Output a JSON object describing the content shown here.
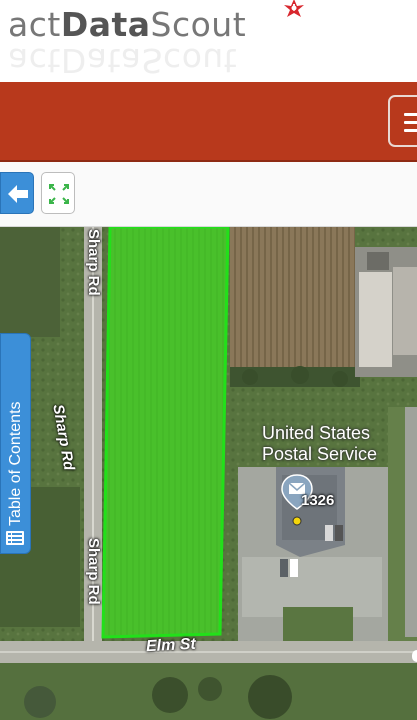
{
  "header": {
    "logo_part1": "act",
    "logo_part2": "Data",
    "logo_part3": "Scout",
    "logo_icon": "red-star-icon"
  },
  "navbar": {
    "menu_icon": "hamburger-menu-icon",
    "accent_color": "#b8391c"
  },
  "toolbar": {
    "back_icon": "arrow-left-icon",
    "extent_icon": "full-extent-icon"
  },
  "map": {
    "roads": {
      "sharp_rd_top": "Sharp Rd",
      "sharp_rd_mid": "Sharp Rd",
      "sharp_rd_bottom": "Sharp Rd",
      "elm_st": "Elm St"
    },
    "poi": {
      "name_line1": "United States",
      "name_line2": "Postal Service",
      "icon": "mail-icon",
      "address": "1326"
    },
    "selection_color": "#22e01a"
  },
  "toc": {
    "label": "Table of Contents",
    "icon": "list-icon"
  }
}
